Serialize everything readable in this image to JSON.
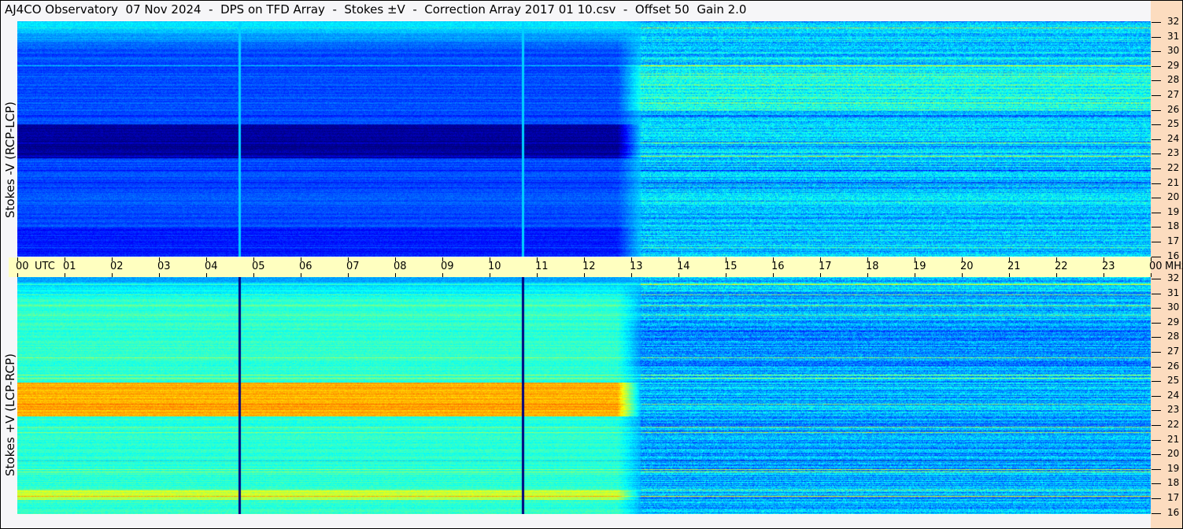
{
  "title": "AJ4CO Observatory  07 Nov 2024  -  DPS on TFD Array  -  Stokes ±V  -  Correction Array 2017 01 10.csv  -  Offset 50  Gain 2.0",
  "panels": [
    {
      "label": "Stokes -V (RCP-LCP)"
    },
    {
      "label": "Stokes +V (LCP-RCP)"
    }
  ],
  "chart_data": {
    "type": "heatmap",
    "title": "AJ4CO Observatory  07 Nov 2024  -  DPS on TFD Array  -  Stokes ±V  -  Correction Array 2017 01 10.csv  -  Offset 50  Gain 2.0",
    "colormap": "jet",
    "x_unit": "UTC",
    "x_ticks": [
      "00",
      "01",
      "02",
      "03",
      "04",
      "05",
      "06",
      "07",
      "08",
      "09",
      "10",
      "11",
      "12",
      "13",
      "14",
      "15",
      "16",
      "17",
      "18",
      "19",
      "20",
      "21",
      "22",
      "23",
      "00"
    ],
    "xlim": [
      0,
      24
    ],
    "y_unit": "MHz",
    "y_ticks": [
      "32",
      "31",
      "30",
      "29",
      "28",
      "27",
      "26",
      "25",
      "24",
      "23",
      "22",
      "21",
      "20",
      "19",
      "18",
      "17",
      "16"
    ],
    "ylim": [
      16,
      32
    ],
    "series": [
      {
        "name": "Stokes -V (RCP-LCP)"
      },
      {
        "name": "Stokes +V (LCP-RCP)"
      }
    ]
  }
}
